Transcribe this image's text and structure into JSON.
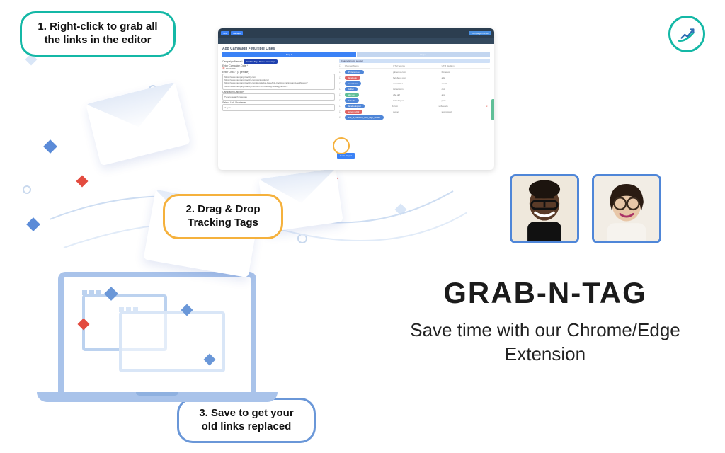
{
  "callouts": {
    "step1": "1. Right-click to grab all the links in the editor",
    "step2": "2. Drag & Drop Tracking Tags",
    "step3": "3. Save to get your old links replaced"
  },
  "headline": {
    "title": "GRAB-N-TAG",
    "subtitle": "Save time with our Chrome/Edge Extension"
  },
  "app": {
    "topButtons": {
      "a": "New",
      "b": "Manage",
      "right": "CampaignTracker"
    },
    "pageTitle": "Add Campaign > Multiple Links",
    "step1Label": "Step 1",
    "step2Label": "Step 2",
    "campaignNameLabel": "Campaign Name *",
    "campaignNameValue": "Grab-N-Tag | Demo Campaign",
    "dateLabel": "Enter Campaign Date *",
    "dateValue": "10/31/2022",
    "linksLabel": "Enter Links * (1 per line)",
    "linksText": "https://www.campaigntrackly.com/\nhttps://www.campaigntrackly.com/pricing-plans/\nhttps://www.campaigntrackly.com/knowledge-base/link-tracking-training-and-certification/\nhttps://www.campaigntrackly.com/utm-link-tracking-strategy-and-b...",
    "categoryLabel": "Campaign Category",
    "categoryPlaceholder": "Type to search category",
    "shortenerLabel": "Select Link Shortener",
    "shortenerValue": "ct.ly.su",
    "saveBtn": "Go to Step 2",
    "rightPanelTitle": "Channels (utm_source)",
    "cols": {
      "c1": "Channel Name",
      "c2": "UTM Source",
      "c3": "UTM Medium"
    },
    "rows": [
      {
        "tag": "Pinterest.def",
        "src": "pinterest.com",
        "med": "Pinterest"
      },
      {
        "tag": "facebook",
        "src": "facebook.com",
        "med": "ads"
      },
      {
        "tag": "newsletter",
        "src": "newsletter",
        "med": "email"
      },
      {
        "tag": "twitter",
        "src": "twitter.com",
        "med": "cpc"
      },
      {
        "tag": "abc.def",
        "src": "abc.def",
        "med": "abc"
      },
      {
        "tag": "linkedin",
        "src": "linkedinpost",
        "med": "paid"
      },
      {
        "tag": "facebookpost",
        "src": "fb.com",
        "med": "unbounce"
      },
      {
        "tag": "survey1242",
        "src": "survey",
        "med": "sponsored"
      },
      {
        "tag": "this_is_medium_with_high_hopes",
        "src": "",
        "med": ""
      }
    ]
  },
  "icons": {
    "logo": "chart-up-icon"
  }
}
